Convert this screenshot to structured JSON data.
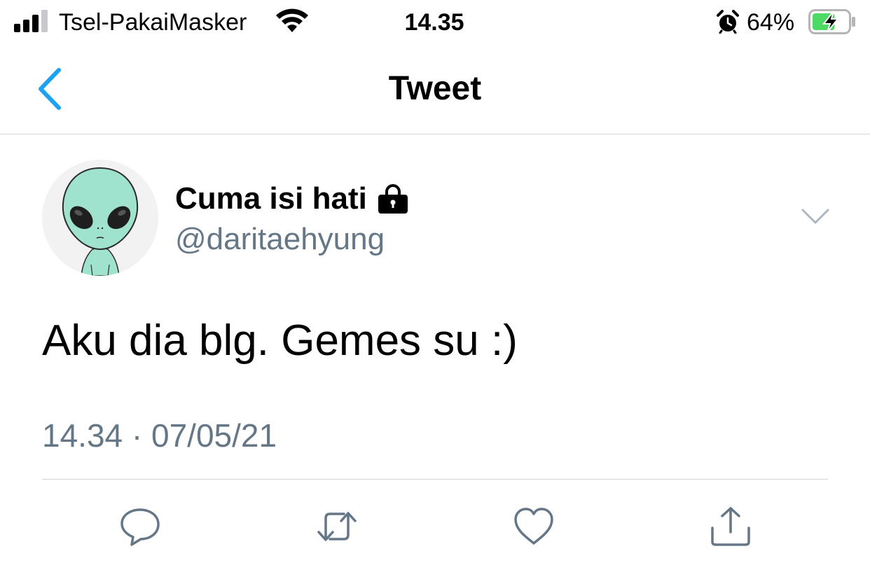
{
  "status_bar": {
    "carrier": "Tsel-PakaiMasker",
    "time": "14.35",
    "battery_percent": "64%",
    "battery_level": 0.64,
    "charging": true,
    "icons": [
      "signal-icon",
      "wifi-icon",
      "alarm-icon",
      "battery-charging-icon"
    ]
  },
  "nav": {
    "title": "Tweet",
    "back_icon": "chevron-left-icon"
  },
  "tweet": {
    "display_name": "Cuma isi hati",
    "protected_icon": "lock-icon",
    "handle": "@daritaehyung",
    "text": "Aku dia blg. Gemes su :)",
    "timestamp": "14.34 · 07/05/21",
    "more_icon": "chevron-down-icon",
    "avatar": "alien-avatar"
  },
  "actions": [
    {
      "name": "reply",
      "icon": "reply-icon"
    },
    {
      "name": "retweet",
      "icon": "retweet-icon"
    },
    {
      "name": "like",
      "icon": "heart-icon"
    },
    {
      "name": "share",
      "icon": "share-icon"
    }
  ],
  "colors": {
    "accent": "#1da1f2",
    "secondary_text": "#657786",
    "icon_gray": "#657786",
    "divider": "#cfd4d9",
    "battery_green": "#4cd964"
  }
}
